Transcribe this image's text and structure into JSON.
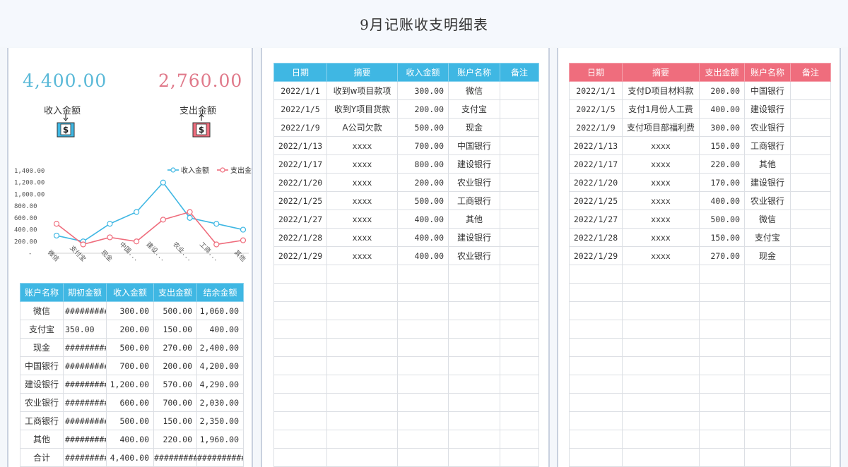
{
  "page": {
    "title": "9月记账收支明细表"
  },
  "summary": {
    "income_total": "4,400.00",
    "expense_total": "2,760.00",
    "income_label": "收入金额",
    "expense_label": "支出金额"
  },
  "colors": {
    "income": "#3fb7e3",
    "expense": "#ef6d7d",
    "income_text": "#5ab9d8",
    "expense_text": "#e0798a"
  },
  "chart_data": {
    "type": "line",
    "categories": [
      "微信",
      "支付宝",
      "现金",
      "中国...",
      "建设...",
      "农业...",
      "工商...",
      "其他"
    ],
    "series": [
      {
        "name": "收入金额",
        "values": [
          300,
          200,
          500,
          700,
          1200,
          600,
          500,
          400
        ]
      },
      {
        "name": "支出金额",
        "values": [
          500,
          150,
          270,
          200,
          570,
          700,
          150,
          220
        ]
      }
    ],
    "legend": [
      "收入金额",
      "支出金"
    ],
    "ytick_labels": [
      "1,400.00",
      "1,200.00",
      "1,000.00",
      "800.00",
      "600.00",
      "400.00",
      "200.00",
      "-"
    ],
    "ylim": [
      0,
      1400
    ],
    "legend_position": "top-right",
    "grid": false
  },
  "accounts": {
    "headers": [
      "账户名称",
      "期初金额",
      "收入金额",
      "支出金额",
      "结余金额"
    ],
    "rows": [
      [
        "微信",
        "#########",
        "300.00",
        "500.00",
        "1,060.00"
      ],
      [
        "支付宝",
        "350.00",
        "200.00",
        "150.00",
        "400.00"
      ],
      [
        "现金",
        "#########",
        "500.00",
        "270.00",
        "2,400.00"
      ],
      [
        "中国银行",
        "#########",
        "700.00",
        "200.00",
        "4,200.00"
      ],
      [
        "建设银行",
        "#########",
        "1,200.00",
        "570.00",
        "4,290.00"
      ],
      [
        "农业银行",
        "#########",
        "600.00",
        "700.00",
        "2,030.00"
      ],
      [
        "工商银行",
        "#########",
        "500.00",
        "150.00",
        "2,350.00"
      ],
      [
        "其他",
        "#########",
        "400.00",
        "220.00",
        "1,960.00"
      ],
      [
        "合计",
        "#########",
        "4,400.00",
        "#########",
        "##########"
      ]
    ]
  },
  "income_table": {
    "headers": [
      "日期",
      "摘要",
      "收入金额",
      "账户名称",
      "备注"
    ],
    "rows": [
      [
        "2022/1/1",
        "收到w项目款项",
        "300.00",
        "微信",
        ""
      ],
      [
        "2022/1/5",
        "收到Y项目货款",
        "200.00",
        "支付宝",
        ""
      ],
      [
        "2022/1/9",
        "A公司欠款",
        "500.00",
        "现金",
        ""
      ],
      [
        "2022/1/13",
        "xxxx",
        "700.00",
        "中国银行",
        ""
      ],
      [
        "2022/1/17",
        "xxxx",
        "800.00",
        "建设银行",
        ""
      ],
      [
        "2022/1/20",
        "xxxx",
        "200.00",
        "农业银行",
        ""
      ],
      [
        "2022/1/25",
        "xxxx",
        "500.00",
        "工商银行",
        ""
      ],
      [
        "2022/1/27",
        "xxxx",
        "400.00",
        "其他",
        ""
      ],
      [
        "2022/1/28",
        "xxxx",
        "400.00",
        "建设银行",
        ""
      ],
      [
        "2022/1/29",
        "xxxx",
        "400.00",
        "农业银行",
        ""
      ]
    ],
    "empty_rows": 11
  },
  "expense_table": {
    "headers": [
      "日期",
      "摘要",
      "支出金额",
      "账户名称",
      "备注"
    ],
    "rows": [
      [
        "2022/1/1",
        "支付D项目材料款",
        "200.00",
        "中国银行",
        ""
      ],
      [
        "2022/1/5",
        "支付1月份人工费",
        "400.00",
        "建设银行",
        ""
      ],
      [
        "2022/1/9",
        "支付项目部福利费",
        "300.00",
        "农业银行",
        ""
      ],
      [
        "2022/1/13",
        "xxxx",
        "150.00",
        "工商银行",
        ""
      ],
      [
        "2022/1/17",
        "xxxx",
        "220.00",
        "其他",
        ""
      ],
      [
        "2022/1/20",
        "xxxx",
        "170.00",
        "建设银行",
        ""
      ],
      [
        "2022/1/25",
        "xxxx",
        "400.00",
        "农业银行",
        ""
      ],
      [
        "2022/1/27",
        "xxxx",
        "500.00",
        "微信",
        ""
      ],
      [
        "2022/1/28",
        "xxxx",
        "150.00",
        "支付宝",
        ""
      ],
      [
        "2022/1/29",
        "xxxx",
        "270.00",
        "现金",
        ""
      ]
    ],
    "empty_rows": 11
  }
}
